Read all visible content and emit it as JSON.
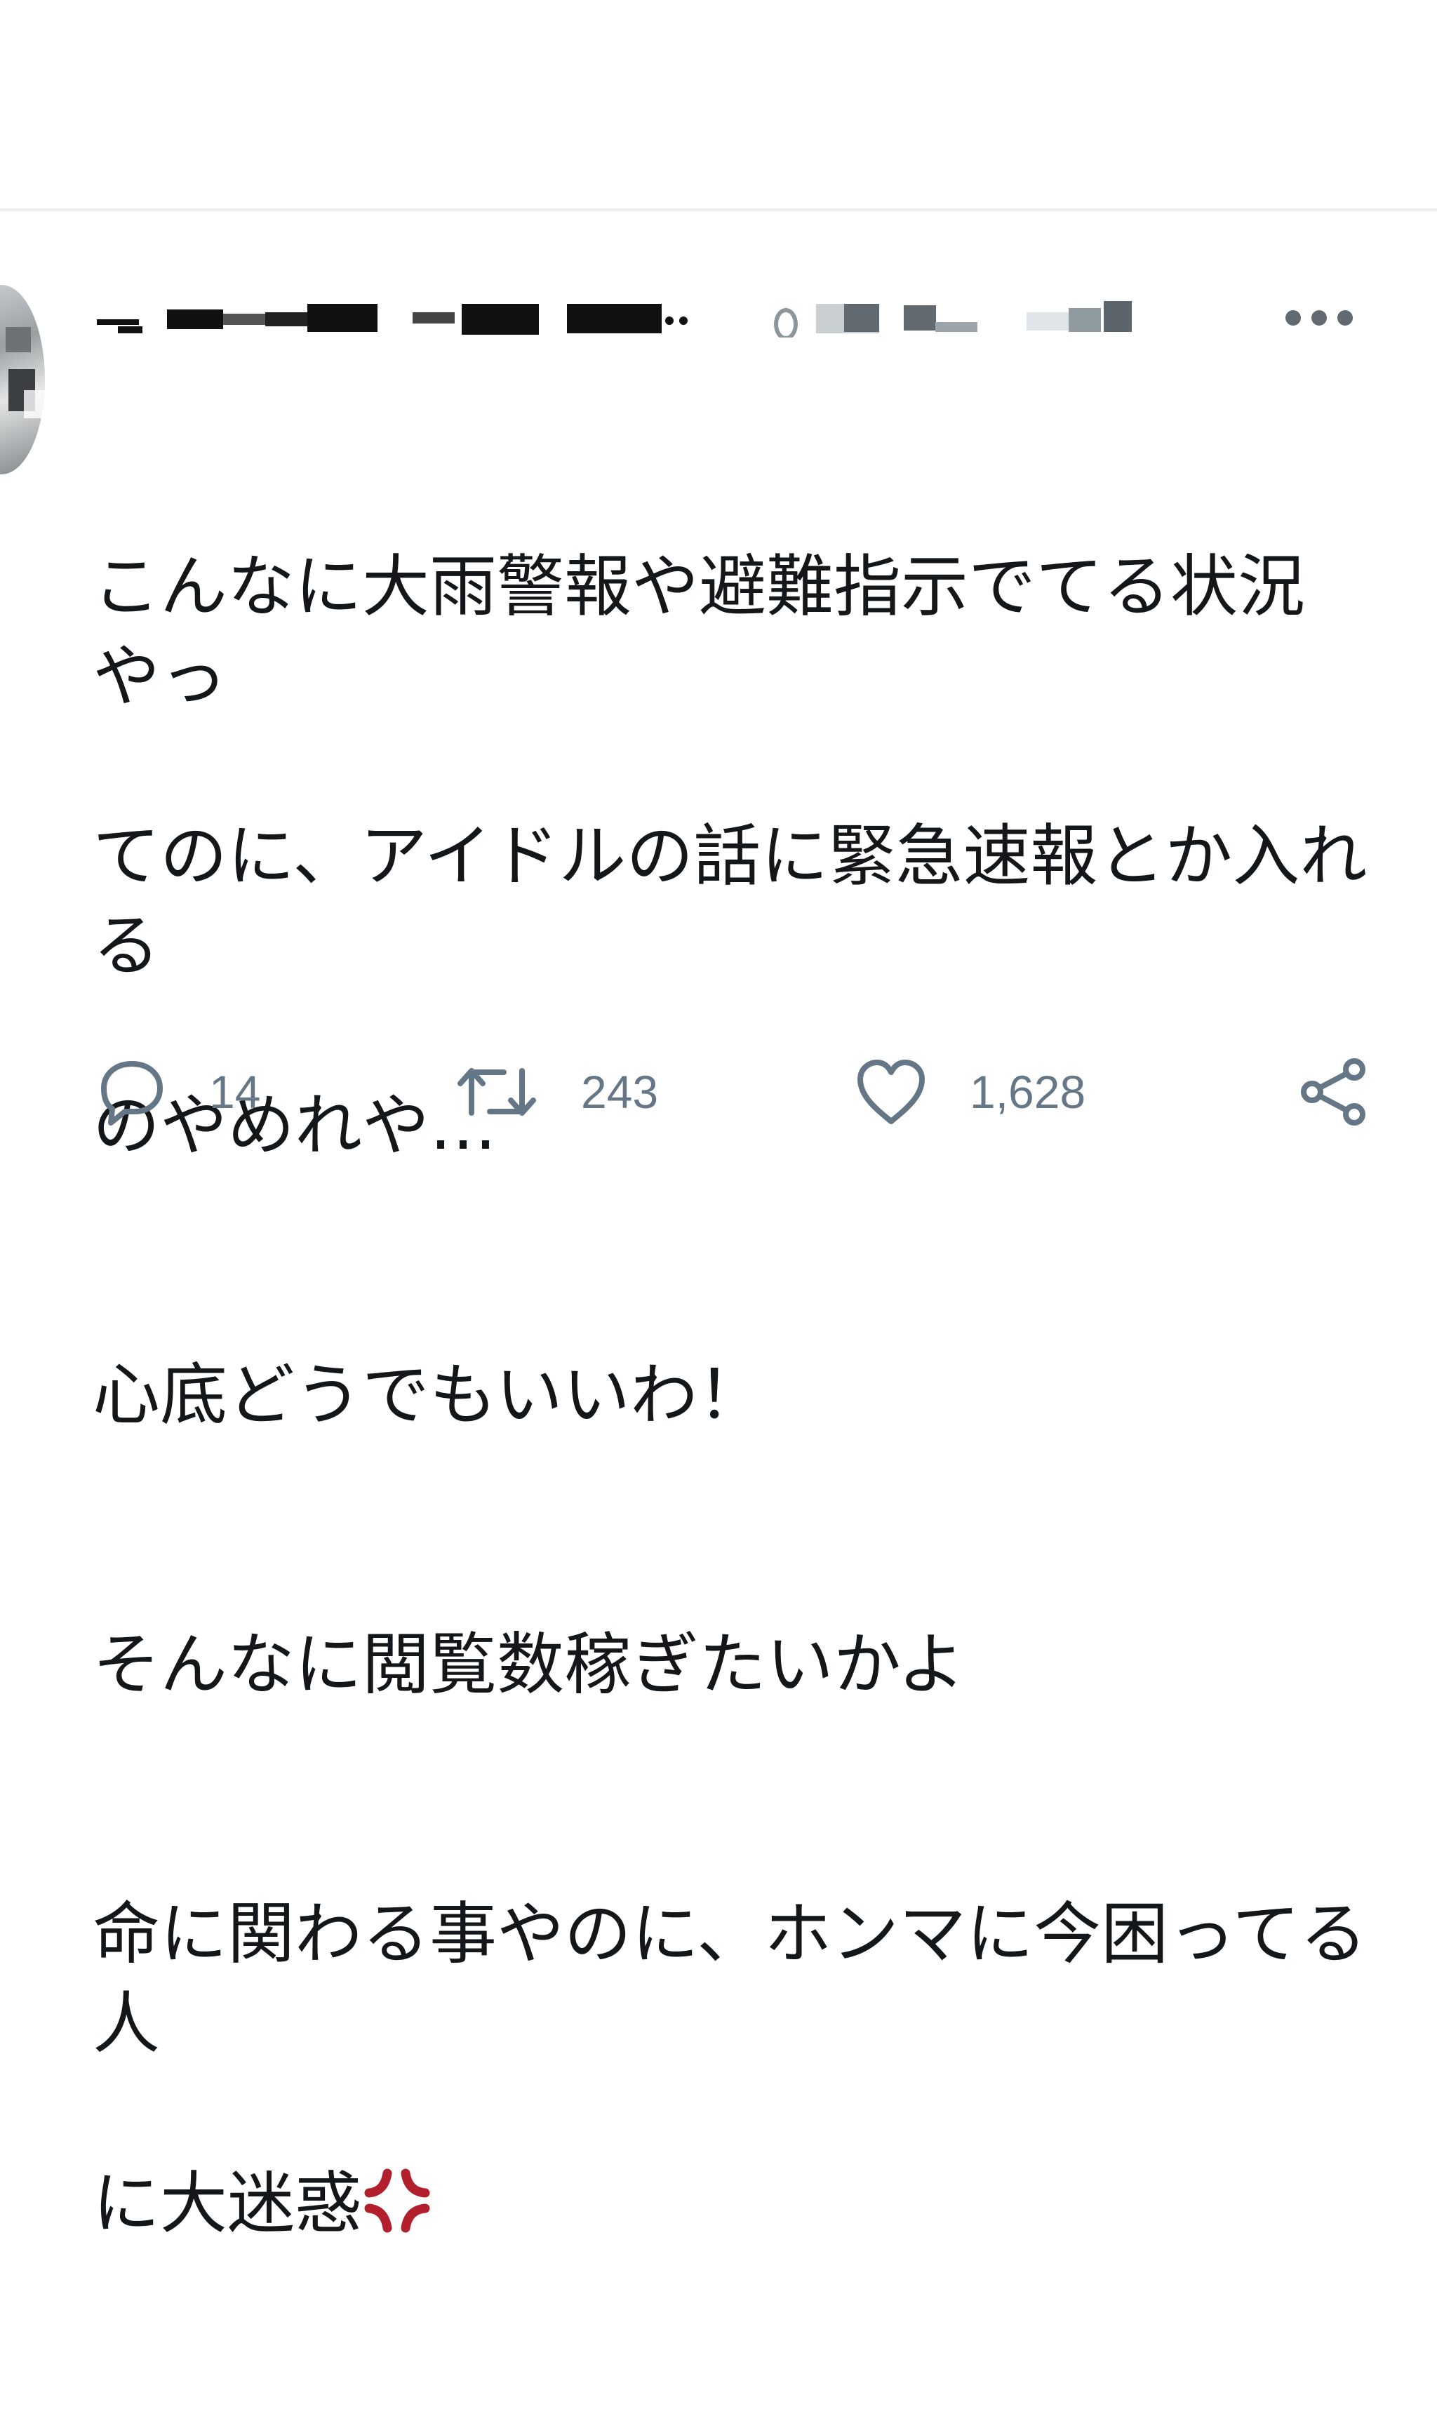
{
  "tweet": {
    "display_name": "",
    "handle": "",
    "text_lines": [
      "こんなに大雨警報や避難指示でてる状況やっ",
      "てのに、アイドルの話に緊急速報とか入れる",
      "のやめれや…",
      "心底どうでもいいわ！",
      "そんなに閲覧数稼ぎたいかよ",
      "命に関わる事やのに、ホンマに今困ってる人",
      "に大迷惑"
    ],
    "emoji": "anger-symbol"
  },
  "actions": {
    "reply_count": "14",
    "retweet_count": "243",
    "like_count": "1,628"
  },
  "colors": {
    "icon": "#657786",
    "text": "#14171a",
    "anger": "#b3202d"
  }
}
